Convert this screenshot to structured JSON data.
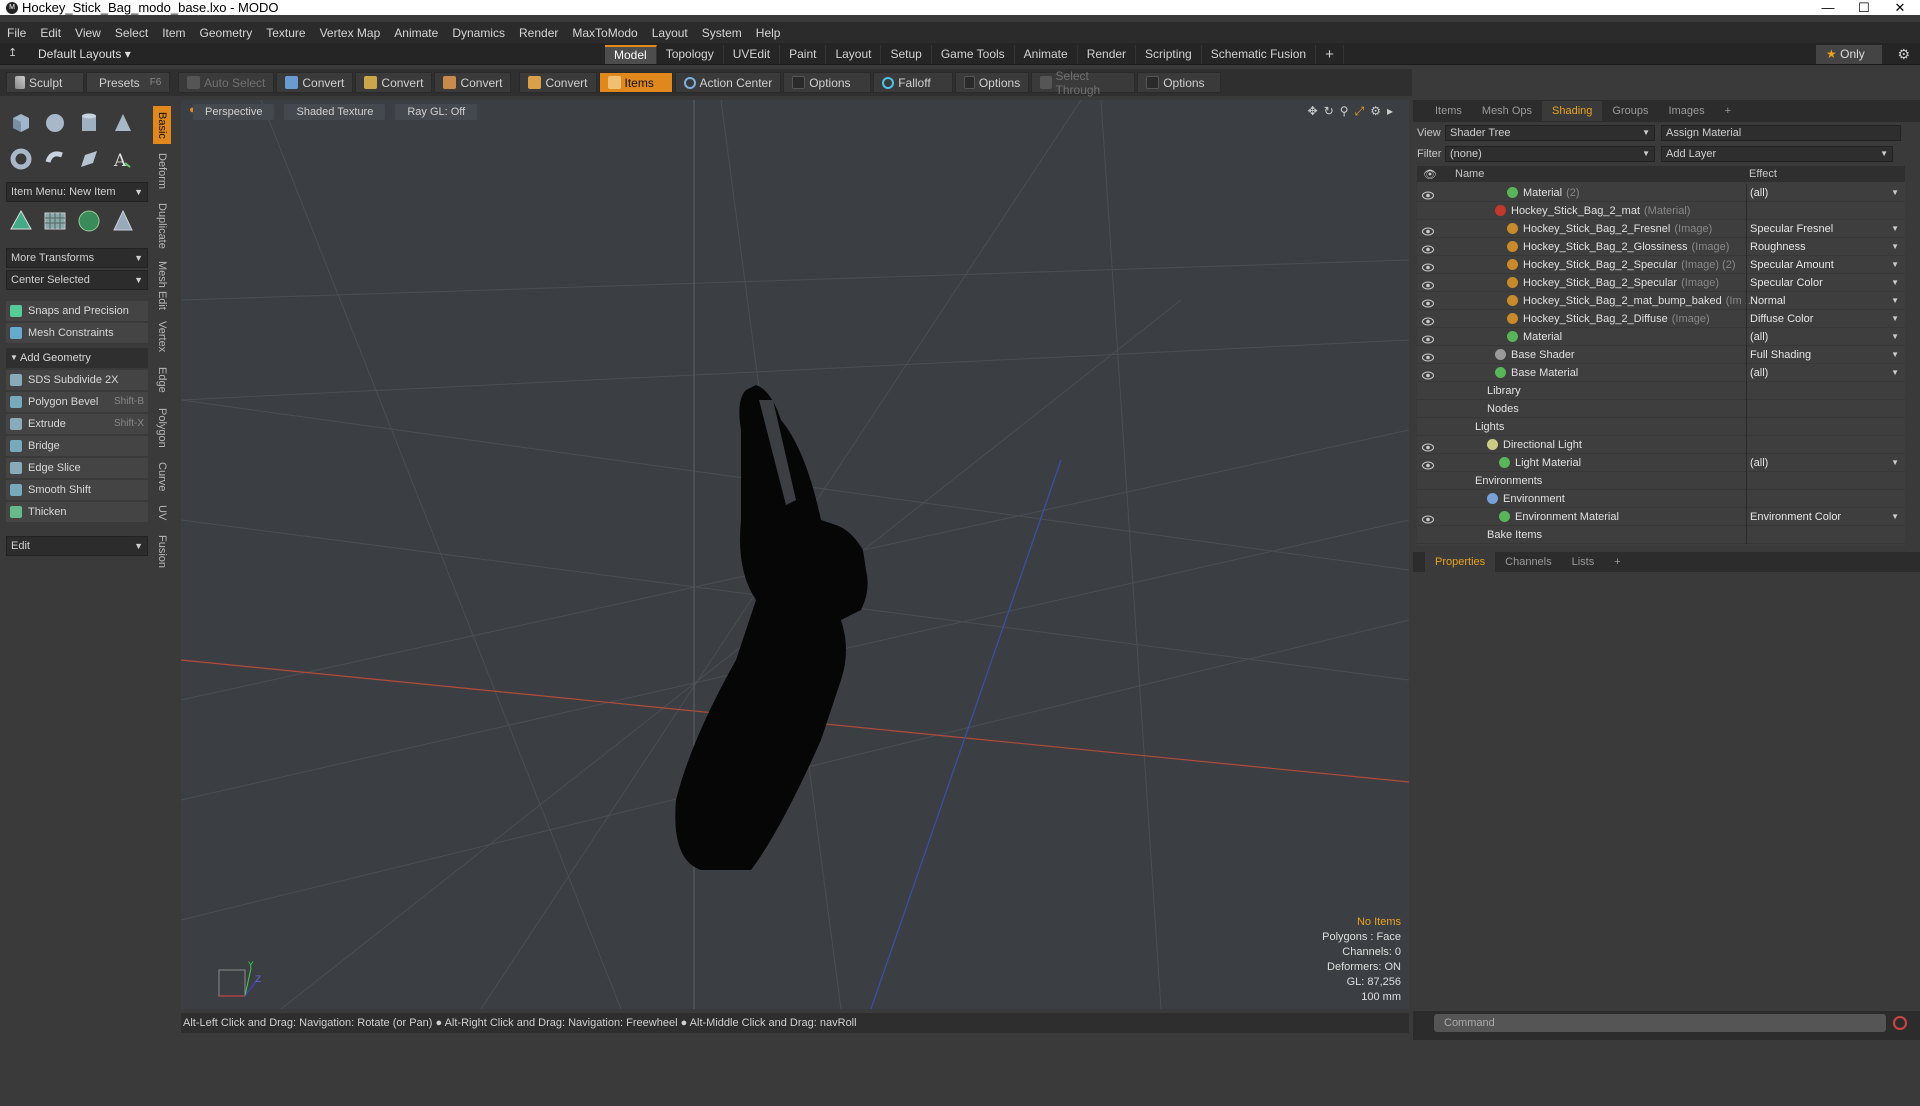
{
  "window": {
    "title": "Hockey_Stick_Bag_modo_base.lxo - MODO"
  },
  "menu": [
    "File",
    "Edit",
    "View",
    "Select",
    "Item",
    "Geometry",
    "Texture",
    "Vertex Map",
    "Animate",
    "Dynamics",
    "Render",
    "MaxToModo",
    "Layout",
    "System",
    "Help"
  ],
  "layoutbar": {
    "layout_selector": "Default Layouts",
    "tabs": [
      "Model",
      "Topology",
      "UVEdit",
      "Paint",
      "Layout",
      "Setup",
      "Game Tools",
      "Animate",
      "Render",
      "Scripting",
      "Schematic Fusion"
    ],
    "active_tab": "Model",
    "only_label": "Only"
  },
  "toolbar": {
    "sculpt": "Sculpt",
    "presets": "Presets",
    "presets_key": "F6",
    "auto_select": "Auto Select",
    "convert": "Convert",
    "items": "Items",
    "action_center": "Action Center",
    "options": "Options",
    "falloff": "Falloff",
    "select_through": "Select Through"
  },
  "left": {
    "item_menu": "Item Menu: New Item",
    "more_transforms": "More Transforms",
    "center_selected": "Center Selected",
    "snaps": "Snaps and Precision",
    "mesh_constraints": "Mesh Constraints",
    "add_geometry": "Add Geometry",
    "tools": [
      {
        "label": "SDS Subdivide 2X",
        "shortcut": ""
      },
      {
        "label": "Polygon Bevel",
        "shortcut": "Shift-B"
      },
      {
        "label": "Extrude",
        "shortcut": "Shift-X"
      },
      {
        "label": "Bridge",
        "shortcut": ""
      },
      {
        "label": "Edge Slice",
        "shortcut": ""
      },
      {
        "label": "Smooth Shift",
        "shortcut": ""
      },
      {
        "label": "Thicken",
        "shortcut": ""
      }
    ],
    "edit": "Edit",
    "vtabs": [
      "Basic",
      "Deform",
      "Duplicate",
      "Mesh Edit",
      "Vertex",
      "Edge",
      "Polygon",
      "Curve",
      "UV",
      "Fusion"
    ]
  },
  "viewport": {
    "perspective": "Perspective",
    "shading": "Shaded Texture",
    "raygl": "Ray GL: Off",
    "info": {
      "no_items": "No Items",
      "polygons": "Polygons : Face",
      "channels": "Channels: 0",
      "deformers": "Deformers: ON",
      "gl": "GL: 87,256",
      "scale": "100 mm"
    }
  },
  "status": "Alt-Left Click and Drag: Navigation: Rotate (or Pan) ●  Alt-Right Click and Drag: Navigation: Freewheel ●  Alt-Middle Click and Drag: navRoll",
  "right": {
    "tabs": [
      "Items",
      "Mesh Ops",
      "Shading",
      "Groups",
      "Images"
    ],
    "active_tab": "Shading",
    "view_label": "View",
    "view_value": "Shader Tree",
    "assign_material": "Assign Material",
    "filter_label": "Filter",
    "filter_value": "(none)",
    "add_layer": "Add Layer",
    "col_name": "Name",
    "col_effect": "Effect",
    "rows": [
      {
        "name": "Material",
        "sub": "(2)",
        "effect": "(all)"
      },
      {
        "name": "Hockey_Stick_Bag_2_mat",
        "sub": "(Material)",
        "effect": ""
      },
      {
        "name": "Hockey_Stick_Bag_2_Fresnel",
        "sub": "(Image)",
        "effect": "Specular Fresnel"
      },
      {
        "name": "Hockey_Stick_Bag_2_Glossiness",
        "sub": "(Image)",
        "effect": "Roughness"
      },
      {
        "name": "Hockey_Stick_Bag_2_Specular",
        "sub": "(Image) (2)",
        "effect": "Specular Amount"
      },
      {
        "name": "Hockey_Stick_Bag_2_Specular",
        "sub": "(Image)",
        "effect": "Specular Color"
      },
      {
        "name": "Hockey_Stick_Bag_2_mat_bump_baked",
        "sub": "(Im ...",
        "effect": "Normal"
      },
      {
        "name": "Hockey_Stick_Bag_2_Diffuse",
        "sub": "(Image)",
        "effect": "Diffuse Color"
      },
      {
        "name": "Material",
        "sub": "",
        "effect": "(all)"
      },
      {
        "name": "Base Shader",
        "sub": "",
        "effect": "Full Shading"
      },
      {
        "name": "Base Material",
        "sub": "",
        "effect": "(all)"
      },
      {
        "name": "Library",
        "sub": "",
        "effect": ""
      },
      {
        "name": "Nodes",
        "sub": "",
        "effect": ""
      },
      {
        "name": "Lights",
        "sub": "",
        "effect": ""
      },
      {
        "name": "Directional Light",
        "sub": "",
        "effect": ""
      },
      {
        "name": "Light Material",
        "sub": "",
        "effect": "(all)"
      },
      {
        "name": "Environments",
        "sub": "",
        "effect": ""
      },
      {
        "name": "Environment",
        "sub": "",
        "effect": ""
      },
      {
        "name": "Environment Material",
        "sub": "",
        "effect": "Environment Color"
      },
      {
        "name": "Bake Items",
        "sub": "",
        "effect": ""
      }
    ],
    "ptabs": [
      "Properties",
      "Channels",
      "Lists"
    ],
    "active_ptab": "Properties",
    "command_placeholder": "Command"
  },
  "colors": {
    "accent": "#e0881c",
    "viewport_bg": "#3b3f44"
  }
}
